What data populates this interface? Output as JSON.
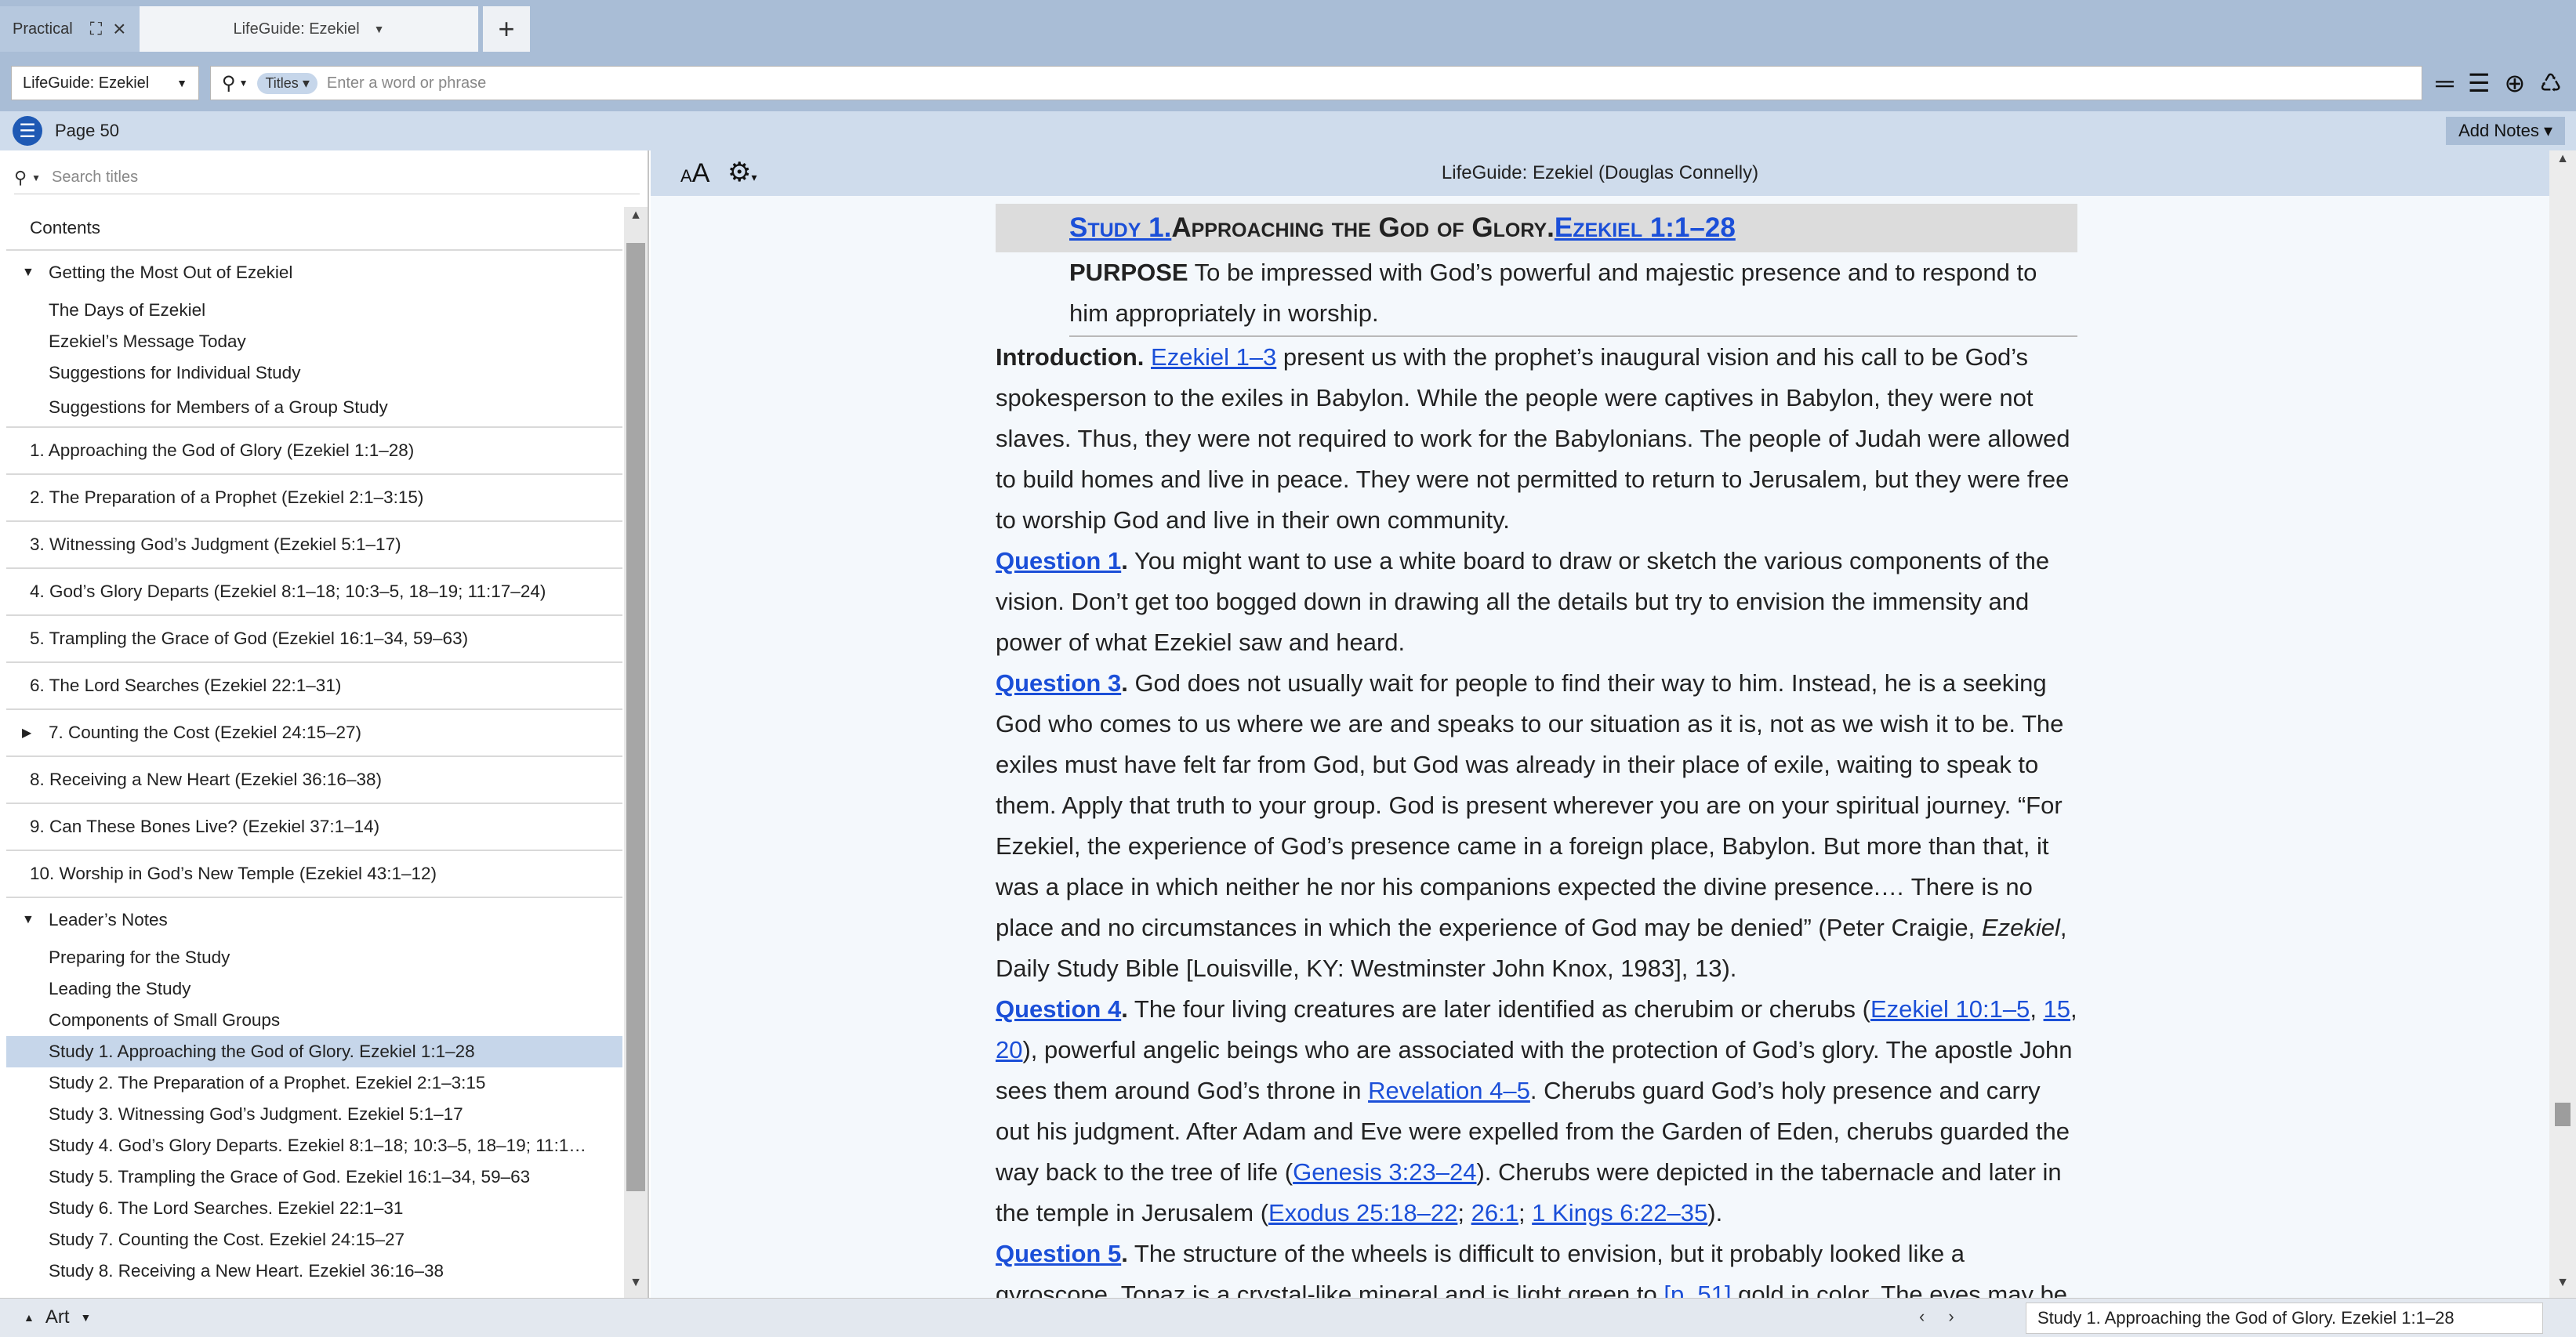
{
  "tabs": {
    "practical": "Practical",
    "active": "LifeGuide: Ezekiel",
    "add": "+"
  },
  "toolbar": {
    "resource": "LifeGuide: Ezekiel",
    "scope": "Titles",
    "placeholder": "Enter a word or phrase"
  },
  "pagebar": {
    "page": "Page 50",
    "add_notes": "Add Notes"
  },
  "sidebar": {
    "search_placeholder": "Search titles",
    "toc": [
      {
        "label": "Contents",
        "level": 0,
        "sep": true
      },
      {
        "label": "Getting the Most Out of Ezekiel",
        "level": 0,
        "tri": "▼"
      },
      {
        "label": "The Days of Ezekiel",
        "level": 1
      },
      {
        "label": "Ezekiel’s Message Today",
        "level": 1
      },
      {
        "label": "Suggestions for Individual Study",
        "level": 1
      },
      {
        "label": "Suggestions for Members of a Group Study",
        "level": 1,
        "sep": true
      },
      {
        "label": "1. Approaching the God of Glory (Ezekiel 1:1–28)",
        "level": 0,
        "sep": true
      },
      {
        "label": "2. The Preparation of a Prophet (Ezekiel 2:1–3:15)",
        "level": 0,
        "sep": true
      },
      {
        "label": "3. Witnessing God’s Judgment (Ezekiel 5:1–17)",
        "level": 0,
        "sep": true
      },
      {
        "label": "4. God’s Glory Departs (Ezekiel 8:1–18; 10:3–5, 18–19; 11:17–24)",
        "level": 0,
        "sep": true
      },
      {
        "label": "5. Trampling the Grace of God (Ezekiel 16:1–34, 59–63)",
        "level": 0,
        "sep": true
      },
      {
        "label": "6. The Lord Searches (Ezekiel 22:1–31)",
        "level": 0,
        "sep": true
      },
      {
        "label": "7. Counting the Cost (Ezekiel 24:15–27)",
        "level": 0,
        "tri": "▶",
        "sep": true
      },
      {
        "label": "8. Receiving a New Heart (Ezekiel 36:16–38)",
        "level": 0,
        "sep": true
      },
      {
        "label": "9. Can These Bones Live?  (Ezekiel 37:1–14)",
        "level": 0,
        "sep": true
      },
      {
        "label": "10. Worship in God’s New Temple (Ezekiel 43:1–12)",
        "level": 0,
        "sep": true
      },
      {
        "label": "Leader’s Notes",
        "level": 0,
        "tri": "▼"
      },
      {
        "label": "Preparing for the Study",
        "level": 1
      },
      {
        "label": "Leading the Study",
        "level": 1
      },
      {
        "label": "Components of Small Groups",
        "level": 1
      },
      {
        "label": "Study 1. Approaching the God of Glory. Ezekiel 1:1–28",
        "level": 1,
        "selected": true
      },
      {
        "label": "Study 2. The Preparation of a Prophet. Ezekiel 2:1–3:15",
        "level": 1
      },
      {
        "label": "Study 3. Witnessing God’s Judgment. Ezekiel 5:1–17",
        "level": 1
      },
      {
        "label": "Study 4. God’s Glory Departs. Ezekiel 8:1–18; 10:3–5, 18–19; 11:1…",
        "level": 1
      },
      {
        "label": "Study 5. Trampling the Grace of God. Ezekiel 16:1–34, 59–63",
        "level": 1
      },
      {
        "label": "Study 6. The Lord Searches. Ezekiel 22:1–31",
        "level": 1
      },
      {
        "label": "Study 7. Counting the Cost. Ezekiel 24:15–27",
        "level": 1
      },
      {
        "label": "Study 8. Receiving a New Heart. Ezekiel 36:16–38",
        "level": 1
      }
    ]
  },
  "content": {
    "header_title": "LifeGuide: Ezekiel (Douglas Connelly)",
    "font_button": "AA",
    "study_link": "Study 1.",
    "study_title": " Approaching the God of Glory. ",
    "study_ref": "Ezekiel 1:1–28",
    "purpose_label": "PURPOSE",
    "purpose_text": " To be impressed with God’s powerful and majestic presence and to respond to him appropriately in worship.",
    "intro_label": "Introduction.",
    "intro_link": "Ezekiel 1–3",
    "intro_text": " present us with the prophet’s inaugural vision and his call to be God’s spokesperson to the exiles in Babylon. While the people were captives in Babylon, they were not slaves. Thus, they were not required to work for the Babylonians. The people of Judah were allowed to build homes and live in peace. They were not permitted to return to Jerusalem, but they were free to worship God and live in their own community.",
    "q1_label": "Question 1",
    "q1_text": " You might want to use a white board to draw or sketch the various components of the vision. Don’t get too bogged down in drawing all the details but try to envision the immensity and power of what Ezekiel saw and heard.",
    "q3_label": "Question 3",
    "q3_text_a": " God does not usually wait for people to find their way to him. Instead, he is a seeking God who comes to us where we are and speaks to our situation as it is, not as we wish it to be. The exiles must have felt far from God, but God was already in their place of exile, waiting to speak to them. Apply that truth to your group. God is present wherever you are on your spiritual journey. “For Ezekiel, the experience of God’s presence came in a foreign place, Babylon. But more than that, it was a place in which neither he nor his companions expected the divine presence.… There is no place and no circumstances in which the experience of God may be denied” (Peter Craigie, ",
    "q3_italic": "Ezekiel",
    "q3_text_b": ", Daily Study Bible [Louisville, KY: Westminster John Knox, 1983], 13).",
    "q4_label": "Question 4",
    "q4_text_a": " The four living creatures are later identified as cherubim or cherubs (",
    "q4_link_a": "Ezekiel 10:1–5",
    "q4_link_b": "15",
    "q4_link_c": "20",
    "q4_text_b": "), powerful angelic beings who are associated with the protection of God’s glory. The apostle John sees them around God’s throne in ",
    "q4_link_d": "Revelation 4–5",
    "q4_text_c": ". Cherubs guard God’s holy presence and carry out his judgment. After Adam and Eve were expelled from the Garden of Eden, cherubs guarded the way back to the tree of life (",
    "q4_link_e": "Genesis 3:23–24",
    "q4_text_d": "). Cherubs were depicted in the tabernacle and later in the temple in Jerusalem (",
    "q4_link_f": "Exodus 25:18–22",
    "q4_link_g": "26:1",
    "q4_link_h": "1 Kings 6:22–35",
    "q4_text_e": ").",
    "q5_label": "Question 5",
    "q5_text_a": " The structure of the wheels is difficult to envision, but it probably looked like a gyroscope. Topaz is a crystal-like mineral and is light green to ",
    "q5_link": "[p. 51]",
    "q5_text_b": " gold in color. The eyes may be gleams of light"
  },
  "statusbar": {
    "art": "Art",
    "location": "Study 1. Approaching the God of Glory. Ezekiel 1:1–28"
  }
}
